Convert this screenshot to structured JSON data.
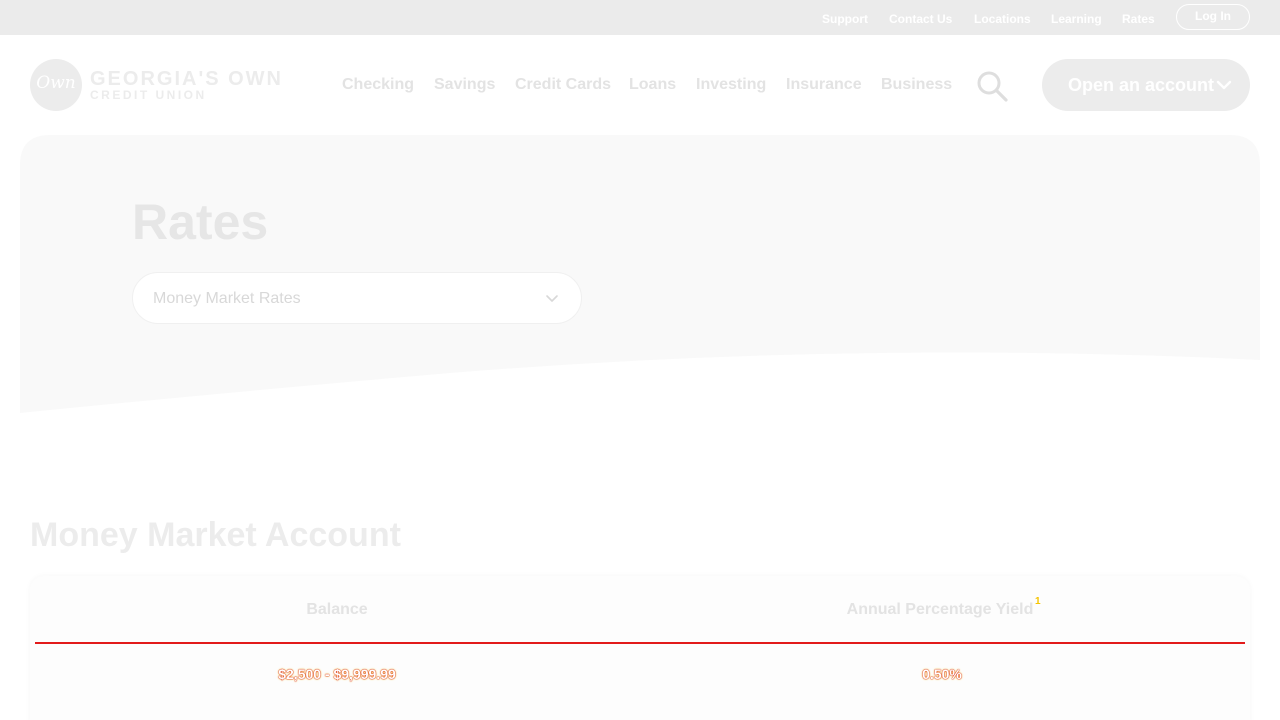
{
  "utility_nav": {
    "links": [
      "Support",
      "Contact Us",
      "Locations",
      "Learning",
      "Rates"
    ],
    "login_label": "Log In"
  },
  "logo": {
    "script": "Own",
    "title": "GEORGIA'S OWN",
    "subtitle": "CREDIT UNION"
  },
  "main_nav": {
    "items": [
      "Checking",
      "Savings",
      "Credit Cards",
      "Loans",
      "Investing",
      "Insurance",
      "Business"
    ],
    "search_icon": "search-icon",
    "cta_label": "Open an account"
  },
  "hero": {
    "title": "Rates",
    "select_value": "Money Market Rates"
  },
  "section": {
    "title": "Money Market Account",
    "table": {
      "headers": [
        "Balance",
        "Annual Percentage Yield"
      ],
      "header_footnote": "1",
      "rows": [
        [
          "$2,500 - $9,999.99",
          "0.50%"
        ]
      ]
    }
  },
  "colors": {
    "utility_bar": "#ebebeb",
    "divider": "#e21b1b",
    "footnote": "#f5c400"
  }
}
